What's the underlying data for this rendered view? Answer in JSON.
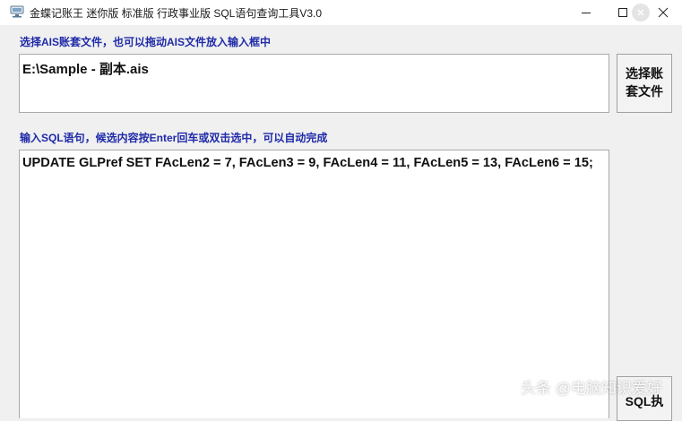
{
  "window": {
    "title": "金蝶记账王 迷你版 标准版 行政事业版 SQL语句查询工具V3.0",
    "icon": "app-icon",
    "controls": [
      "minimize-icon",
      "maximize-icon",
      "help-icon",
      "close-icon"
    ]
  },
  "file_section": {
    "label": "选择AIS账套文件，也可以拖动AIS文件放入输入框中",
    "value": "E:\\Sample - 副本.ais",
    "button_line1": "选择账",
    "button_line2": "套文件"
  },
  "sql_section": {
    "label": "输入SQL语句，候选内容按Enter回车或双击选中，可以自动完成",
    "value": "UPDATE GLPref SET FAcLen2 = 7, FAcLen3 = 9, FAcLen4 = 11, FAcLen5 = 13, FAcLen6 = 15;",
    "exec_button": "SQL执"
  },
  "watermark": "头条 @电脑知识爱好",
  "colors": {
    "label": "#1f2aa8",
    "background": "#f0f0f0",
    "input_bg": "#ffffff"
  }
}
